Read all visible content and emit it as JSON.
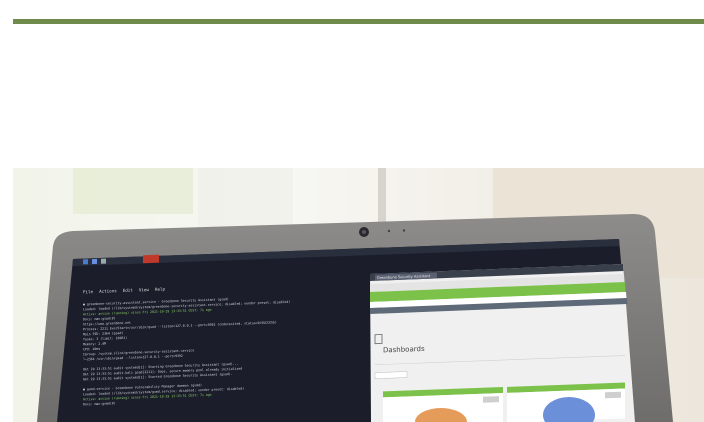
{
  "colors": {
    "accent_bar": "#6f8a4a",
    "terminal_bg": "#1b1e2a",
    "browser_bg": "#f2f2f2",
    "browser_accent": "#7cc24a",
    "chart_orange": "#e59b5a",
    "chart_blue": "#6b8fd8"
  },
  "terminal": {
    "menu": [
      "File",
      "Actions",
      "Edit",
      "View",
      "Help"
    ],
    "lines": [
      "● greenbone-security-assistant.service - Greenbone Security Assistant (gsad)",
      "   Loaded: loaded (/lib/systemd/system/greenbone-security-assistant.service; disabled; vendor preset: disabled)",
      "   Active: active (running) since Fri 2021-10-29 13:33:51 CEST; 7s ago",
      "     Docs: man:gsad(8)",
      "           https://www.greenbone.net",
      "  Process: 2211 ExecStart=/usr/sbin/gsad --listen=127.0.0.1 --port=9392 (code=exited, status=0/SUCCESS)",
      " Main PID: 2364 (gsad)",
      "    Tasks: 3 (limit: 19081)",
      "   Memory: 2.4M",
      "      CPU: 49ms",
      "   CGroup: /system.slice/greenbone-security-assistant.service",
      "           └─2364 /usr/sbin/gsad --listen=127.0.0.1 --port=9392",
      "",
      "Okt 29 13:33:51 audit systemd[1]: Starting Greenbone Security Assistant (gsad)...",
      "Okt 29 13:33:51 audit-kali gsad[2211]: Oops, secure memory pool already initialized",
      "Okt 29 13:33:51 audit systemd[1]: Started Greenbone Security Assistant (gsad).",
      "",
      "● gvmd.service - Greenbone Vulnerability Manager daemon (gvmd)",
      "   Loaded: loaded (/lib/systemd/system/gvmd.service; disabled; vendor preset: disabled)",
      "   Active: active (running) since Fri 2021-10-29 13:33:51 CEST; 7s ago",
      "     Docs: man:gvmd(8)"
    ]
  },
  "browser": {
    "tab_label": "Greenbone Security Assistant",
    "page_title": "Dashboards"
  }
}
